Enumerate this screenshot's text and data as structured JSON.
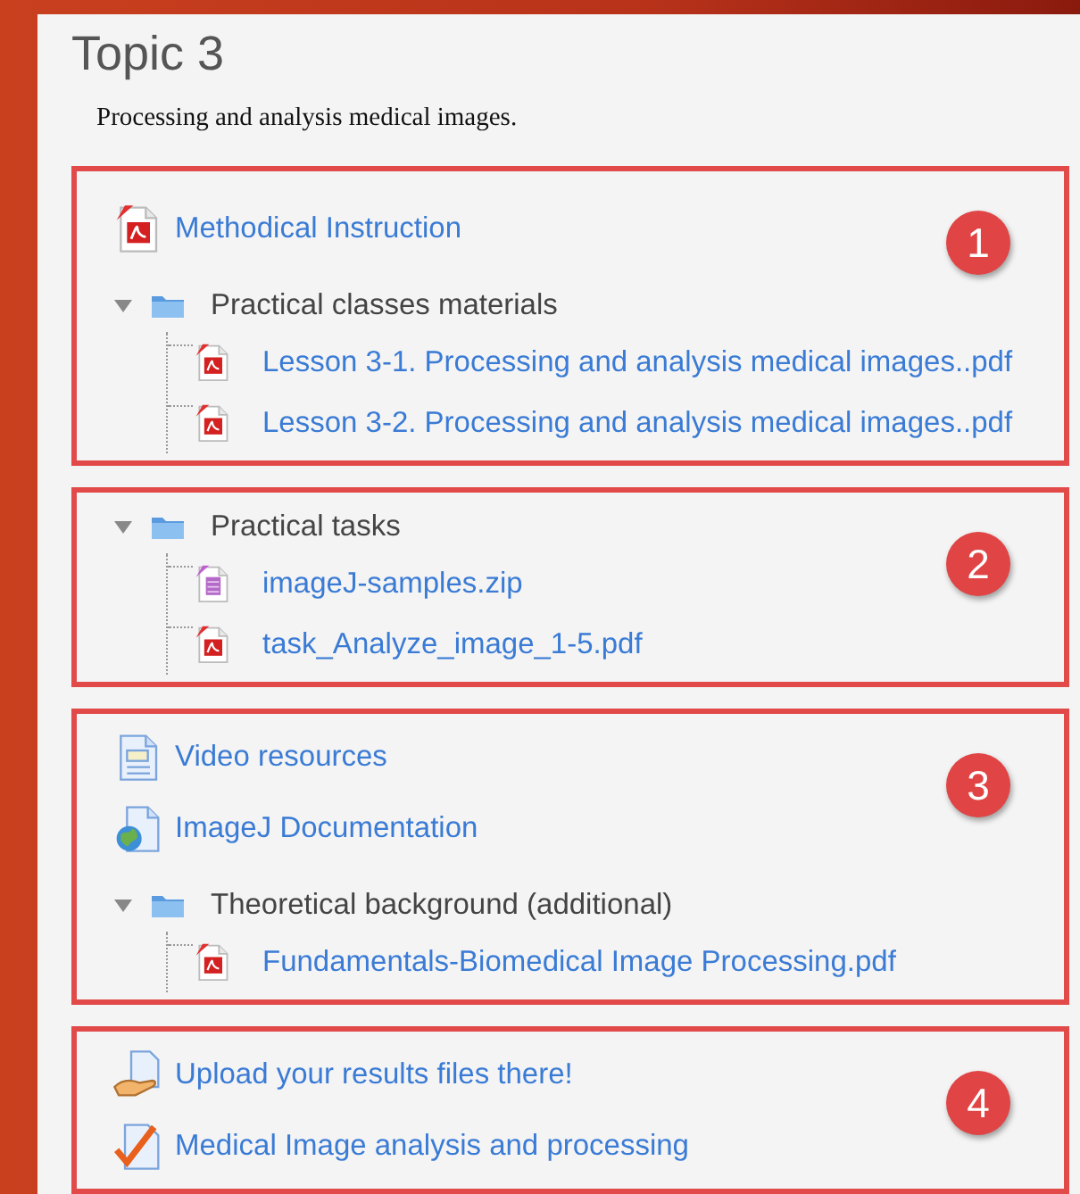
{
  "topic": {
    "title": "Topic 3",
    "summary": "Processing and analysis medical images."
  },
  "groups": [
    {
      "badge": "1",
      "items": [
        {
          "kind": "pdf",
          "label": "Methodical Instruction"
        },
        {
          "kind": "folder",
          "label": "Practical classes materials",
          "expanded": true,
          "children": [
            {
              "kind": "pdf",
              "label": "Lesson 3-1. Processing and analysis medical images..pdf"
            },
            {
              "kind": "pdf",
              "label": "Lesson 3-2. Processing and analysis medical images..pdf"
            }
          ]
        }
      ]
    },
    {
      "badge": "2",
      "items": [
        {
          "kind": "folder",
          "label": "Practical tasks",
          "expanded": true,
          "children": [
            {
              "kind": "zip",
              "label": "imageJ-samples.zip"
            },
            {
              "kind": "pdf",
              "label": "task_Analyze_image_1-5.pdf"
            }
          ]
        }
      ]
    },
    {
      "badge": "3",
      "items": [
        {
          "kind": "page",
          "label": "Video resources"
        },
        {
          "kind": "url",
          "label": "ImageJ Documentation"
        },
        {
          "kind": "folder",
          "label": "Theoretical background (additional)",
          "expanded": true,
          "children": [
            {
              "kind": "pdf",
              "label": "Fundamentals-Biomedical Image Processing.pdf"
            }
          ]
        }
      ]
    },
    {
      "badge": "4",
      "items": [
        {
          "kind": "upload",
          "label": "Upload your results files there!"
        },
        {
          "kind": "assign",
          "label": "Medical Image analysis and processing"
        }
      ]
    }
  ]
}
